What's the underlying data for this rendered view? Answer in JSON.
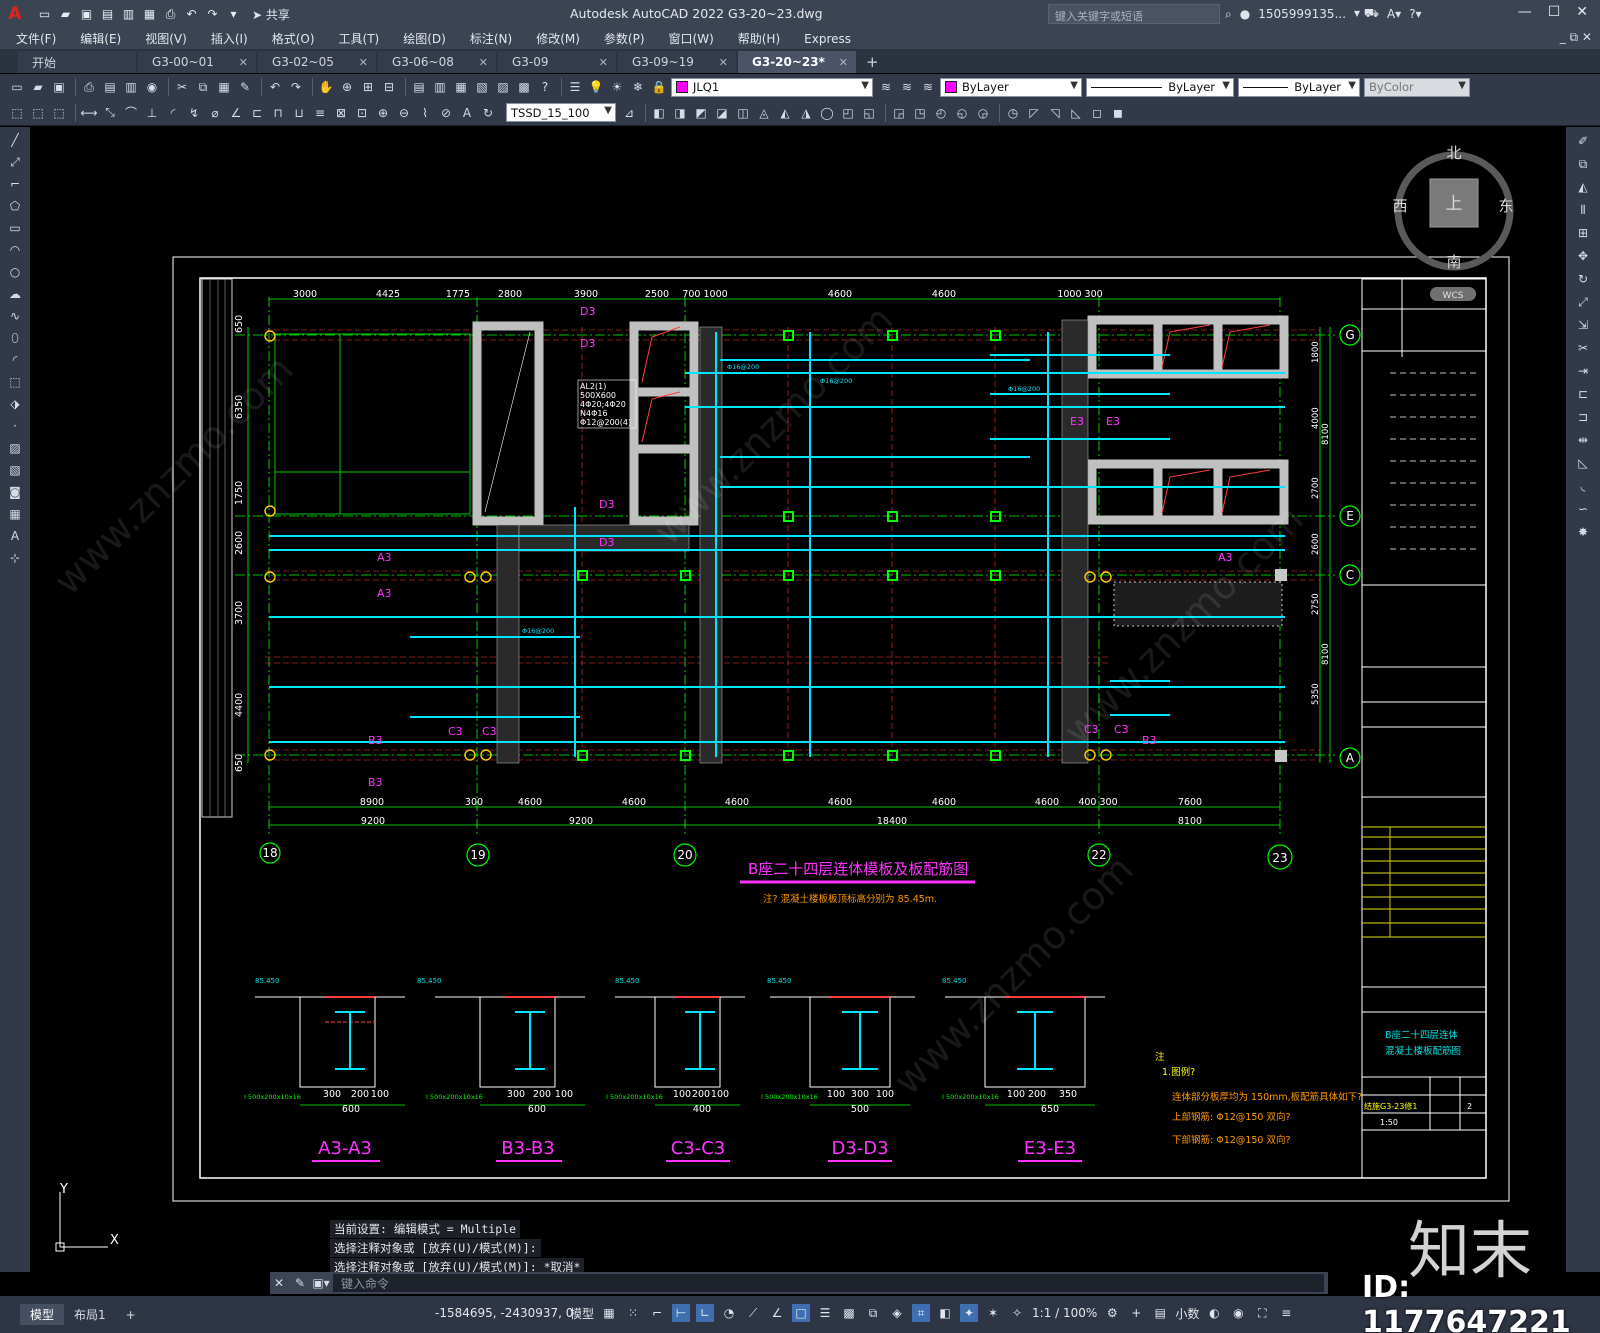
{
  "window": {
    "title": "Autodesk AutoCAD 2022    G3-20~23.dwg",
    "search_placeholder": "键入关键字或短语",
    "user": "1505999135...",
    "share_label": "共享"
  },
  "menu": [
    "文件(F)",
    "编辑(E)",
    "视图(V)",
    "插入(I)",
    "格式(O)",
    "工具(T)",
    "绘图(D)",
    "标注(N)",
    "修改(M)",
    "参数(P)",
    "窗口(W)",
    "帮助(H)",
    "Express"
  ],
  "doc_tabs": [
    {
      "label": "开始",
      "active": false
    },
    {
      "label": "G3-00~01",
      "active": false
    },
    {
      "label": "G3-02~05",
      "active": false
    },
    {
      "label": "G3-06~08",
      "active": false
    },
    {
      "label": "G3-09",
      "active": false
    },
    {
      "label": "G3-09~19",
      "active": false
    },
    {
      "label": "G3-20~23*",
      "active": true
    }
  ],
  "toolbar": {
    "layer": "JLQ1",
    "text_style": "TSSD_15_100",
    "color": "ByLayer",
    "linetype": "ByLayer",
    "lineweight": "ByLayer",
    "plotstyle": "ByColor",
    "layer_color": "#ff00ff"
  },
  "viewcube": {
    "north": "北",
    "south": "南",
    "east": "东",
    "west": "西",
    "top": "上",
    "wcs": "WCS"
  },
  "drawing": {
    "title": "B座二十四层连体模板及板配筋图",
    "note": "注? 混凝土楼板板顶标高分别为 85.45m.",
    "axes_bottom": [
      "18",
      "19",
      "20",
      "22",
      "23"
    ],
    "axes_right": [
      "G",
      "E",
      "C",
      "A"
    ],
    "dims_top": [
      "3000",
      "4425",
      "1775",
      "2800",
      "3900",
      "2500",
      "700 1000",
      "4600",
      "4600",
      "1000 300"
    ],
    "dims_bottom_1": [
      "8900",
      "300",
      "4600",
      "4600",
      "4600",
      "4600",
      "4600",
      "4600",
      "400 300",
      "7600"
    ],
    "dims_bottom_2": [
      "9200",
      "9200",
      "18400",
      "8100"
    ],
    "dims_left": [
      "650",
      "6350",
      "1750",
      "2600",
      "3700",
      "4400",
      "650"
    ],
    "dims_right": [
      "1800",
      "4000",
      "2700",
      "2600",
      "2750",
      "5350",
      "8100",
      "8100"
    ],
    "beam_note": [
      "AL2(1)",
      "500X600",
      "4Φ20;4Φ20",
      "N4Φ16",
      "Φ12@200(4)"
    ],
    "section_labels": [
      "A3-A3",
      "B3-B3",
      "C3-C3",
      "D3-D3",
      "E3-E3"
    ],
    "section_bottom_dims": [
      [
        "300",
        "200",
        "100",
        "600"
      ],
      [
        "300",
        "200",
        "100",
        "600"
      ],
      [
        "100",
        "200",
        "100",
        "400"
      ],
      [
        "100",
        "300",
        "100",
        "500"
      ],
      [
        "100",
        "200",
        "350",
        "650"
      ]
    ],
    "section_elev": "85.450",
    "section_steel": "I 500x200x10x16",
    "notes_title": "注",
    "notes": [
      "1.图例?",
      "连体部分板厚均为 150mm,板配筋具体如下?",
      "上部钢筋: Φ12@150 双向?",
      "下部钢筋: Φ12@150 双向?"
    ],
    "titleblock_name": [
      "B座二十四层连体",
      "混凝土楼板配筋图"
    ],
    "titleblock_drawing_no": "结施G3-23修1",
    "titleblock_scale": "1:50",
    "titleblock_sheet": "2",
    "section_marks": [
      "D3",
      "D3",
      "D3",
      "D3",
      "E3",
      "E3",
      "A3",
      "A3",
      "A3",
      "C3",
      "C3",
      "C3",
      "C3",
      "B3",
      "B3",
      "B3"
    ],
    "rebar_labels": [
      "Φ16@200",
      "Φ16@200",
      "Φ16@200",
      "Φ16@200"
    ]
  },
  "command": {
    "history": [
      "当前设置: 编辑模式 = Multiple",
      "选择注释对象或 [放弃(U)/模式(M)]:",
      "选择注释对象或 [放弃(U)/模式(M)]: *取消*"
    ],
    "placeholder": "键入命令"
  },
  "status": {
    "tabs": [
      "模型",
      "布局1"
    ],
    "coords": "-1584695, -2430937, 0",
    "model": "模型",
    "scale": "1:1 / 100%",
    "units": "小数"
  },
  "watermark": {
    "brand": "知末",
    "id": "ID: 1177647221",
    "site": "www.znzmo.com"
  }
}
